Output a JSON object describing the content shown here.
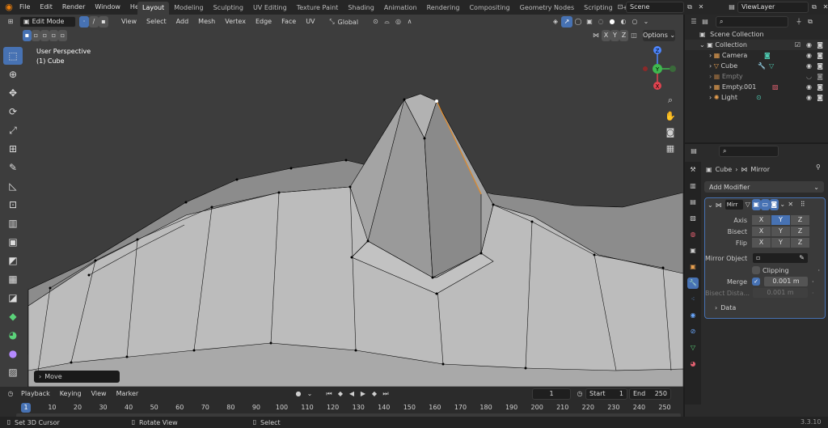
{
  "topbar": {
    "menus": [
      "File",
      "Edit",
      "Render",
      "Window",
      "Help"
    ],
    "workspaces": [
      "Layout",
      "Modeling",
      "Sculpting",
      "UV Editing",
      "Texture Paint",
      "Shading",
      "Animation",
      "Rendering",
      "Compositing",
      "Geometry Nodes",
      "Scripting"
    ],
    "active_workspace": "Layout",
    "add_tab": "+",
    "scene": "Scene",
    "view_layer": "ViewLayer"
  },
  "viewport": {
    "mode": "Edit Mode",
    "menus": [
      "View",
      "Select",
      "Add",
      "Mesh",
      "Vertex",
      "Edge",
      "Face",
      "UV"
    ],
    "orientation": "Global",
    "overlay_title": "User Perspective",
    "overlay_object": "(1) Cube",
    "options": "Options",
    "axis_buttons": [
      "X",
      "Y",
      "Z"
    ],
    "gizmo_labels": [
      "Z",
      "Y",
      "X"
    ],
    "last_op": "Move"
  },
  "timeline": {
    "menus": [
      "Playback",
      "Keying",
      "View",
      "Marker"
    ],
    "current_frame": "1",
    "start_label": "Start",
    "start": "1",
    "end_label": "End",
    "end": "250",
    "ruler": [
      "1",
      "10",
      "20",
      "30",
      "40",
      "50",
      "60",
      "70",
      "80",
      "90",
      "100",
      "110",
      "120",
      "130",
      "140",
      "150",
      "160",
      "170",
      "180",
      "190",
      "200",
      "210",
      "220",
      "230",
      "240",
      "250"
    ]
  },
  "status": {
    "left": "Set 3D Cursor",
    "middle": "Rotate View",
    "right": "Select",
    "version": "3.3.10"
  },
  "outliner": {
    "root": "Scene Collection",
    "collection": "Collection",
    "items": [
      "Camera",
      "Cube",
      "Empty",
      "Empty.001",
      "Light"
    ]
  },
  "properties": {
    "breadcrumb_object": "Cube",
    "breadcrumb_modifier": "Mirror",
    "add_modifier": "Add Modifier",
    "modifier_name": "Mirr",
    "axis_label": "Axis",
    "bisect_label": "Bisect",
    "flip_label": "Flip",
    "xyz": [
      "X",
      "Y",
      "Z"
    ],
    "mirror_object_label": "Mirror Object",
    "clipping_label": "Clipping",
    "merge_label": "Merge",
    "merge_value": "0.001 m",
    "bisect_distance_label": "Bisect Dista...",
    "bisect_distance_value": "0.001 m",
    "data_label": "Data"
  },
  "colors": {
    "accent": "#4772b3",
    "viewport_bg": "#3d3d3d",
    "mesh_face": "#b6b6b6"
  }
}
